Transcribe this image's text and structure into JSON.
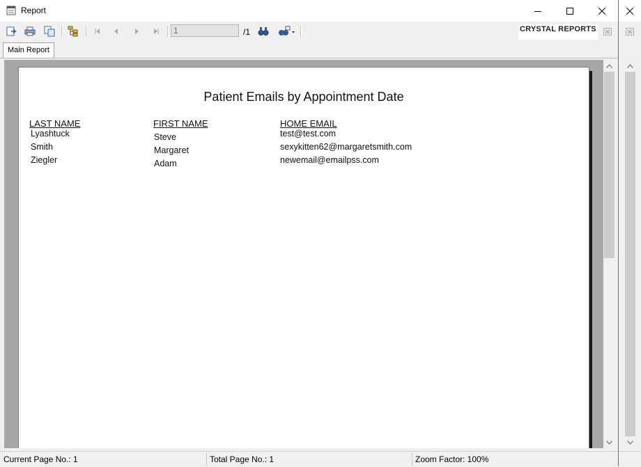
{
  "window": {
    "title": "Report",
    "brand": "CRYSTAL REPORTS",
    "brand_sub": "· · · · ·"
  },
  "toolbar": {
    "page_value": "1",
    "page_total": "/1"
  },
  "tabs": [
    {
      "label": "Main Report"
    }
  ],
  "report": {
    "title": "Patient Emails by Appointment Date",
    "headers": {
      "last": "LAST NAME",
      "first": "FIRST NAME",
      "email": "HOME EMAIL"
    },
    "rows": [
      {
        "last": "Lyashtuck",
        "first": "Steve",
        "email": "test@test.com"
      },
      {
        "last": "Smith",
        "first": "Margaret",
        "email": "sexykitten62@margaretsmith.com"
      },
      {
        "last": "Ziegler",
        "first": "Adam",
        "email": "newemail@emailpss.com"
      }
    ]
  },
  "status": {
    "current_page": "Current Page No.: 1",
    "total_page": "Total Page No.: 1",
    "zoom": "Zoom Factor: 100%"
  }
}
